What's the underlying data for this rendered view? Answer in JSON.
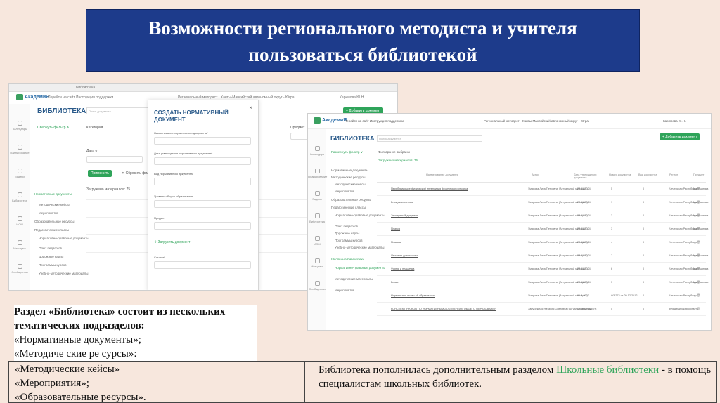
{
  "slide_title_line1": "Возможности регионального методиста и учителя",
  "slide_title_line2": "пользоваться библиотекой",
  "colors": {
    "title_bg": "#1d3b8b",
    "accent_green": "#2fa45a",
    "page_bg": "#f7e7dd"
  },
  "shot1": {
    "browser_tab": "Библиотека",
    "logo_text": "АкадемиЯ",
    "toplinks": "Перейти на сайт    Инструкция поддержки",
    "topcenter": "Региональный методист · Ханты-Мансийский автономный округ - Югра",
    "topuser": "Каримова Ю.Н.",
    "library_title": "БИБЛИОТЕКА",
    "search_placeholder": "Поиск документа",
    "add_button": "+ Добавить документ",
    "filter_link": "Свернуть фильтр ∧",
    "category_label": "Категория",
    "date_label": "Дата от",
    "subject_label": "Предмет",
    "apply_button": "Применить",
    "reset_link": "✕ Сбросить фильтр",
    "uploaded_label": "Загружено материалов: 75",
    "nav": [
      "Календарь",
      "Планирование",
      "Задачи",
      "Библиотека",
      "ИОМ",
      "Методист",
      "Сообщества"
    ],
    "side": [
      "Нормативные документы",
      "Методические кейсы",
      "Мероприятия",
      "Образовательные ресурсы",
      "Педагогические классы",
      "Нормативно-правовые документы",
      "Опыт педагогов",
      "Дорожные карты",
      "Программы курсов",
      "Учебно-методические материалы"
    ],
    "modal": {
      "title": "СОЗДАТЬ НОРМАТИВНЫЙ ДОКУМЕНТ",
      "close": "×",
      "f1": "Наименование нормативного документа*",
      "f2": "Дата утверждения нормативного документа*",
      "f3": "Вид нормативного документа",
      "f4": "Уровень общего образования",
      "f5": "Предмет",
      "upload": "⇪ Загрузить документ",
      "f6": "Ссылка*"
    }
  },
  "shot2": {
    "logo_text": "АкадемиЯ",
    "toplinks": "Перейти на сайт    Инструкция поддержки",
    "topcenter": "Региональный методист · Ханты-Мансийский автономный округ - Югра",
    "topuser": "Каримова Ю.Н.",
    "library_title": "БИБЛИОТЕКА",
    "search_placeholder": "Поиск документа",
    "add_button": "+ Добавить документ",
    "filter_link": "Развернуть фильтр ∨",
    "filters_none": "Фильтры не выбраны",
    "uploaded_label": "Загружено материалов: 76",
    "nav": [
      "Календарь",
      "Планирование",
      "Задачи",
      "Библиотека",
      "ИОМ",
      "Методист",
      "Сообщества"
    ],
    "side": [
      "Нормативные документы",
      "Методические ресурсы",
      "Методические кейсы",
      "Мероприятия",
      "Образовательные ресурсы",
      "Педагогические классы",
      "Нормативно-правовые документы",
      "Опыт педагогов",
      "Дорожные карты",
      "Программы курсов",
      "Учебно-методические материалы",
      "Школьные библиотеки",
      "Нормативно-правовые документы",
      "Методические материалы",
      "Мероприятия"
    ],
    "columns": [
      "Наименование документа",
      "Автор",
      "Дата утверждения документа",
      "Номер документа",
      "Вид документа",
      "Регион",
      "Предмет"
    ],
    "rows": [
      {
        "name": "Перебирающие физический интенсивия физического отклика",
        "author": "Умарова Лиза Петровна (Актуальный методист)",
        "date": "28.11.2024",
        "num": "5",
        "kind": "0",
        "region": "Чеченская Республика",
        "subject": "Математика"
      },
      {
        "name": "Блок диагностика",
        "author": "Умарова Лиза Петровна (Актуальный методист)",
        "date": "28.11.2024",
        "num": "1",
        "kind": "0",
        "region": "Чеченская Республика",
        "subject": "Математика"
      },
      {
        "name": "Экспертный документ",
        "author": "Умарова Лиза Петровна (Актуальный методист)",
        "date": "28.11.2024",
        "num": "3",
        "kind": "0",
        "region": "Чеченская Республика",
        "subject": "Математика"
      },
      {
        "name": "Планка",
        "author": "Умарова Лиза Петровна (Актуальный методист)",
        "date": "28.11.2024",
        "num": "3",
        "kind": "0",
        "region": "Чеченская Республика",
        "subject": "Математика"
      },
      {
        "name": "Плашка",
        "author": "Умарова Лиза Петровна (Актуальный методист)",
        "date": "28.11.2024",
        "num": "4",
        "kind": "0",
        "region": "Чеченская Республика",
        "subject": ""
      },
      {
        "name": "Итоговая диагностика",
        "author": "Умарова Лиза Петровна (Актуальный методист)",
        "date": "28.11.2024",
        "num": "7",
        "kind": "0",
        "region": "Чеченская Республика",
        "subject": "Математика"
      },
      {
        "name": "Форма и плашечка",
        "author": "Умарова Лиза Петровна (Актуальный методист)",
        "date": "28.11.2024",
        "num": "6",
        "kind": "0",
        "region": "Чеченская Республика",
        "subject": "Математика"
      },
      {
        "name": "Бочка",
        "author": "Умарова Лиза Петровна (Актуальный методист)",
        "date": "28.11.2024",
        "num": "3",
        "kind": "0",
        "region": "Чеченская Республика",
        "subject": "Математика"
      },
      {
        "name": "Нормальное право об образовании",
        "author": "Умарова Лиза Петровна (Актуальный методист)",
        "date": "01.4.2023",
        "num": "ФЗ 273 от 29.12.2012",
        "kind": "0",
        "region": "Чеченская Республика",
        "subject": ""
      },
      {
        "name": "КОНСПЕКТ УРОКОВ ПО НОРМАТИВНЫМ ДОКУМЕНТАМ ОБЩЕГО ОБРАЗОВАНИЯ",
        "author": "Зарубежная Наталия Олеговна (Актуальный методист)",
        "date": "17.09.2024",
        "num": "5",
        "kind": "0",
        "region": "Владимирская область",
        "subject": ""
      }
    ]
  },
  "para1_bold": "Раздел «Библиотека» состоит из нескольких тематических подразделов:",
  "para1_line1": "«Нормативные документы»;",
  "para1_line2": "«Методиче ские ре сурсы»:",
  "table_left": [
    "«Методические кейсы»",
    "«Мероприятия»;",
    "«Образовательные ресурсы»."
  ],
  "table_right_pre": "Библиотека пополнилась дополнительным разделом ",
  "table_right_accent": "Школьные библиотеки",
  "table_right_post": " - в помощь специалистам школьных библиотек."
}
